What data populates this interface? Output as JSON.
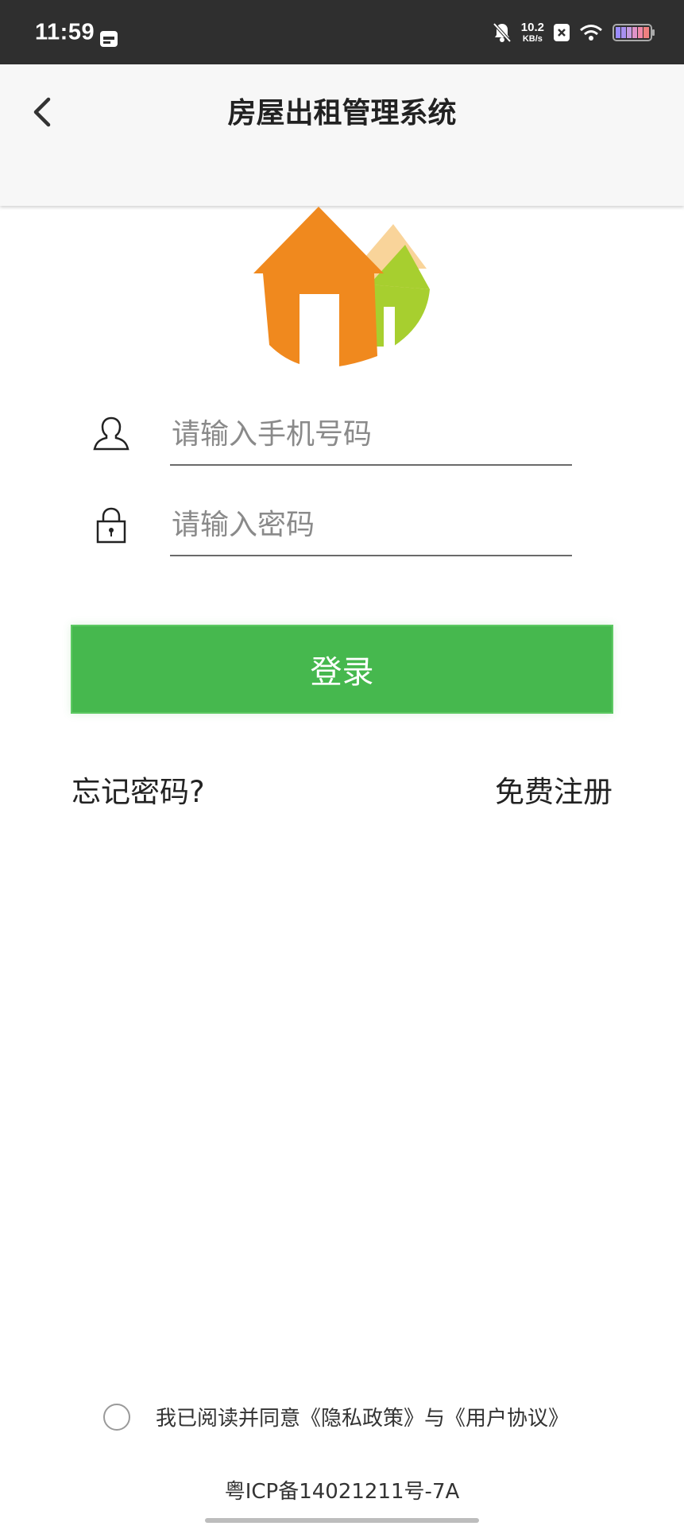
{
  "status_bar": {
    "time": "11:59",
    "net_speed_value": "10.2",
    "net_speed_unit": "KB/s",
    "icons": [
      "calendar-icon",
      "mute-bell-icon",
      "close-box-icon",
      "wifi-icon",
      "battery-icon"
    ]
  },
  "header": {
    "title": "房屋出租管理系统",
    "back_icon": "chevron-left-icon"
  },
  "form": {
    "phone_placeholder": "请输入手机号码",
    "phone_value": "",
    "password_placeholder": "请输入密码",
    "password_value": "",
    "login_label": "登录",
    "forgot_label": "忘记密码?",
    "register_label": "免费注册"
  },
  "agreement": {
    "text": "我已阅读并同意《隐私政策》与《用户协议》",
    "checked": false
  },
  "footer": {
    "icp": "粤ICP备14021211号-7A"
  },
  "colors": {
    "accent_green": "#46b84e",
    "status_bar_bg": "#2f2f2f",
    "logo_orange": "#f0891e",
    "logo_green": "#a7cf2f",
    "logo_peach": "#f9d49a"
  }
}
